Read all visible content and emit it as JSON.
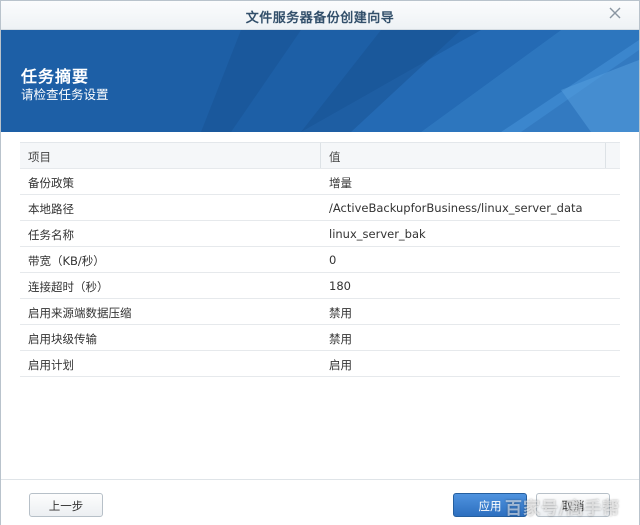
{
  "window": {
    "title": "文件服务器备份创建向导"
  },
  "banner": {
    "heading": "任务摘要",
    "subheading": "请检查任务设置"
  },
  "table": {
    "headers": [
      "项目",
      "值"
    ],
    "rows": [
      {
        "item": "备份政策",
        "value": "增量"
      },
      {
        "item": "本地路径",
        "value": "/ActiveBackupforBusiness/linux_server_data"
      },
      {
        "item": "任务名称",
        "value": "linux_server_bak"
      },
      {
        "item": "带宽（KB/秒）",
        "value": "0"
      },
      {
        "item": "连接超时（秒）",
        "value": "180"
      },
      {
        "item": "启用来源端数据压缩",
        "value": "禁用"
      },
      {
        "item": "启用块级传输",
        "value": "禁用"
      },
      {
        "item": "启用计划",
        "value": "启用"
      }
    ]
  },
  "footer": {
    "prev_label": "上一步",
    "apply_label": "应用",
    "cancel_label": "取消"
  },
  "watermark": "百家号/高手帮",
  "colors": {
    "banner": "#1d5fa6",
    "primary_button": "#2d6fbf"
  },
  "icons": {
    "close": "close-icon"
  }
}
